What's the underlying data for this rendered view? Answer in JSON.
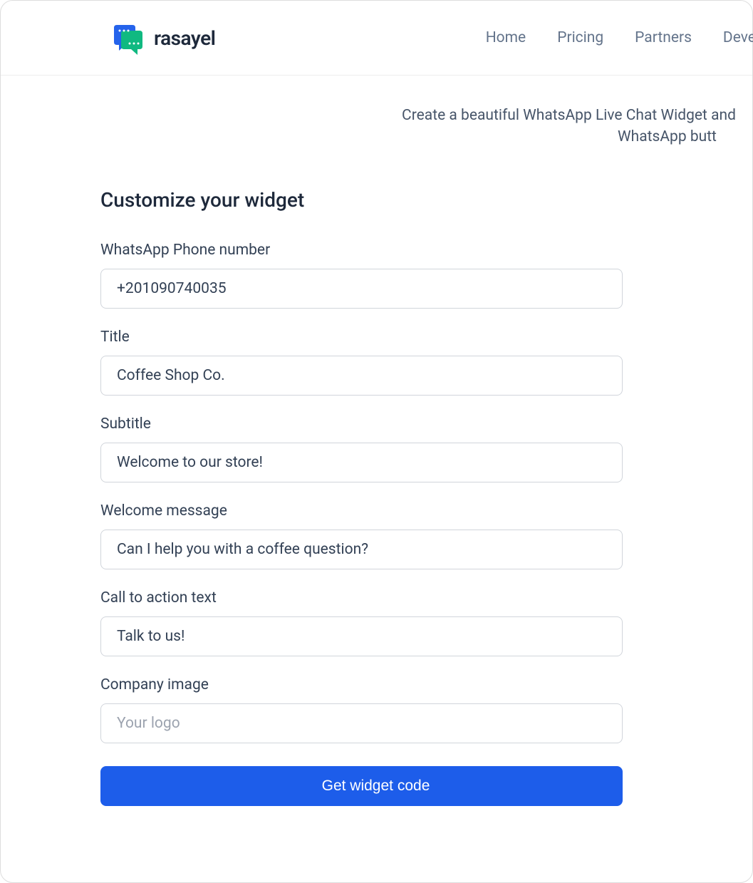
{
  "brand": {
    "name": "rasayel"
  },
  "nav": {
    "items": [
      {
        "label": "Home"
      },
      {
        "label": "Pricing"
      },
      {
        "label": "Partners"
      },
      {
        "label": "Devel"
      }
    ]
  },
  "hero": {
    "line1": "Create a beautiful WhatsApp Live Chat Widget and",
    "line2": "WhatsApp butt"
  },
  "form": {
    "title": "Customize your widget",
    "phone": {
      "label": "WhatsApp Phone number",
      "value": "+201090740035"
    },
    "widget_title": {
      "label": "Title",
      "value": "Coffee Shop Co."
    },
    "subtitle": {
      "label": "Subtitle",
      "value": "Welcome to our store!"
    },
    "welcome": {
      "label": "Welcome message",
      "value": "Can I help you with a coffee question?"
    },
    "cta": {
      "label": "Call to action text",
      "value": "Talk to us!"
    },
    "company_image": {
      "label": "Company image",
      "placeholder": "Your logo",
      "value": ""
    },
    "submit": "Get widget code"
  }
}
